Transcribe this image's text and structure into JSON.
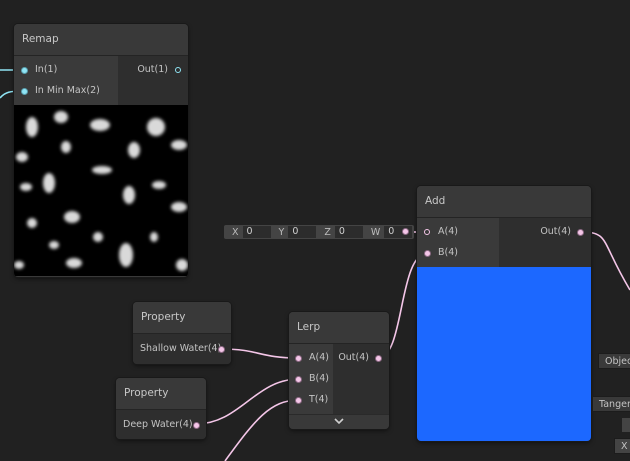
{
  "remap": {
    "title": "Remap",
    "in1": "In(1)",
    "in_min_max": "In Min Max(2)",
    "out": "Out(1)"
  },
  "add": {
    "title": "Add",
    "a": "A(4)",
    "b": "B(4)",
    "out": "Out(4)",
    "preview_color": "#1c68ff"
  },
  "vector_input": {
    "x_label": "X",
    "x_val": "0",
    "y_label": "Y",
    "y_val": "0",
    "z_label": "Z",
    "z_val": "0",
    "w_label": "W",
    "w_val": "0"
  },
  "property1": {
    "title": "Property",
    "output": "Shallow Water(4)"
  },
  "property2": {
    "title": "Property",
    "output": "Deep Water(4)"
  },
  "lerp": {
    "title": "Lerp",
    "a": "A(4)",
    "b": "B(4)",
    "t": "T(4)",
    "out": "Out(4)",
    "collapse_icon": "chevron-down-icon"
  },
  "right_edge": {
    "object_label": "Objec",
    "tangent_label": "Tangen",
    "x_label": "X"
  },
  "colors": {
    "canvas": "#212121",
    "wire_pink": "#f4c6e8",
    "wire_cyan": "#8fe4f4"
  }
}
